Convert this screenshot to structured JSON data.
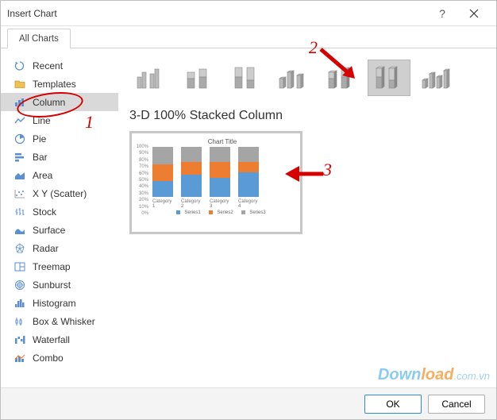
{
  "window": {
    "title": "Insert Chart"
  },
  "tabs": {
    "all": "All Charts"
  },
  "sidebar": {
    "items": [
      {
        "label": "Recent"
      },
      {
        "label": "Templates"
      },
      {
        "label": "Column"
      },
      {
        "label": "Line"
      },
      {
        "label": "Pie"
      },
      {
        "label": "Bar"
      },
      {
        "label": "Area"
      },
      {
        "label": "X Y (Scatter)"
      },
      {
        "label": "Stock"
      },
      {
        "label": "Surface"
      },
      {
        "label": "Radar"
      },
      {
        "label": "Treemap"
      },
      {
        "label": "Sunburst"
      },
      {
        "label": "Histogram"
      },
      {
        "label": "Box & Whisker"
      },
      {
        "label": "Waterfall"
      },
      {
        "label": "Combo"
      }
    ],
    "selected_index": 2
  },
  "main": {
    "title": "3-D 100% Stacked Column",
    "selected_subtype_index": 5
  },
  "chart_data": {
    "type": "bar",
    "title": "Chart Title",
    "categories": [
      "Category 1",
      "Category 2",
      "Category 3",
      "Category 4"
    ],
    "series": [
      {
        "name": "Series1",
        "values": [
          32,
          45,
          38,
          50
        ]
      },
      {
        "name": "Series2",
        "values": [
          33,
          25,
          32,
          20
        ]
      },
      {
        "name": "Series3",
        "values": [
          35,
          30,
          30,
          30
        ]
      }
    ],
    "stacked_percent": true,
    "ylim": [
      0,
      100
    ],
    "yticks": [
      "0%",
      "10%",
      "20%",
      "30%",
      "40%",
      "50%",
      "60%",
      "70%",
      "80%",
      "90%",
      "100%"
    ],
    "colors": {
      "Series1": "#5b9bd5",
      "Series2": "#ed7d31",
      "Series3": "#a5a5a5"
    }
  },
  "footer": {
    "ok": "OK",
    "cancel": "Cancel"
  },
  "annotations": {
    "n1": "1",
    "n2": "2",
    "n3": "3"
  },
  "watermark": {
    "brand_a": "Down",
    "brand_b": "load",
    "tld": ".com.vn"
  }
}
